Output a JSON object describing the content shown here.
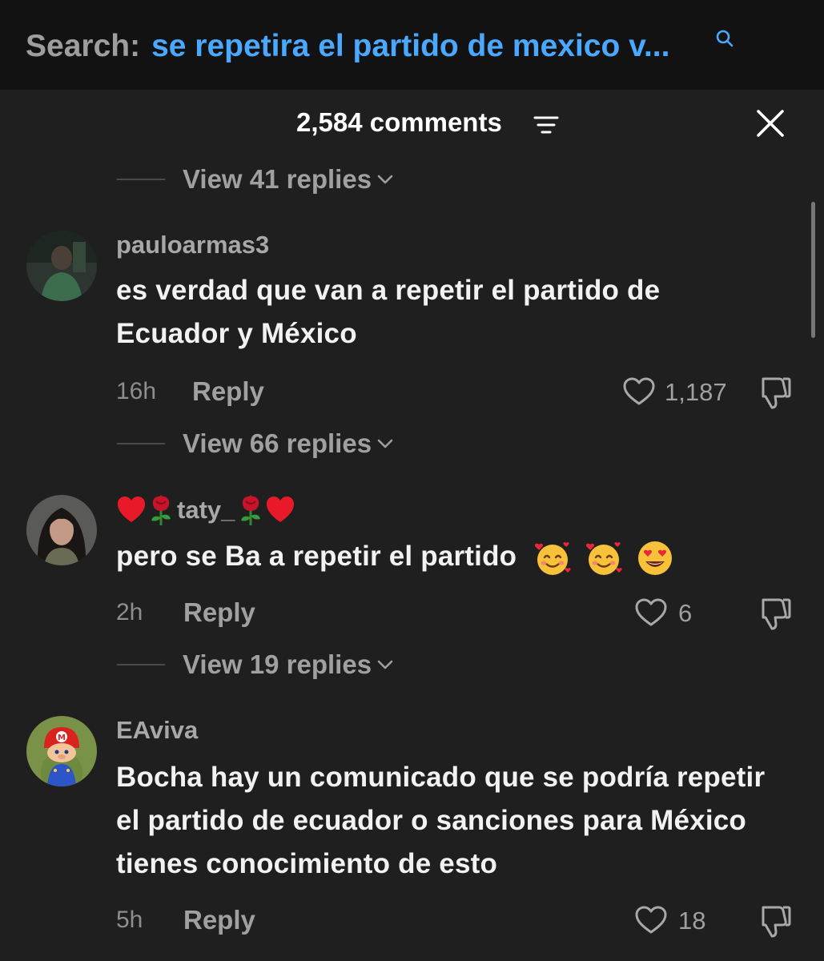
{
  "search": {
    "prefix": "Search:",
    "query": "se repetira el partido de mexico v..."
  },
  "header": {
    "comment_count": "2,584 comments"
  },
  "view_replies": [
    {
      "label": "View 41 replies"
    },
    {
      "label": "View 66 replies"
    },
    {
      "label": "View 19 replies"
    }
  ],
  "comments": [
    {
      "username": "pauloarmas3",
      "text": "es verdad que van a repetir el partido de Ecuador y México",
      "time": "16h",
      "reply_label": "Reply",
      "likes": "1,187"
    },
    {
      "username": "taty_",
      "username_emojis": [
        "heart",
        "rose",
        "rose",
        "heart"
      ],
      "text": "pero se Ba a repetir el partido",
      "text_emojis": [
        "smiling-face-with-hearts",
        "smiling-face-with-hearts",
        "heart-eyes"
      ],
      "time": "2h",
      "reply_label": "Reply",
      "likes": "6"
    },
    {
      "username": "EAviva",
      "text": "Bocha hay un comunicado que se podría repetir el partido de ecuador o sanciones para México tienes conocimiento de esto",
      "time": "5h",
      "reply_label": "Reply",
      "likes": "18"
    }
  ],
  "colors": {
    "background": "#121212",
    "sheet": "#1f1f1f",
    "search_query": "#4aa8ff",
    "muted_text": "#a0a0a0",
    "primary_text": "#f2f2f2"
  }
}
